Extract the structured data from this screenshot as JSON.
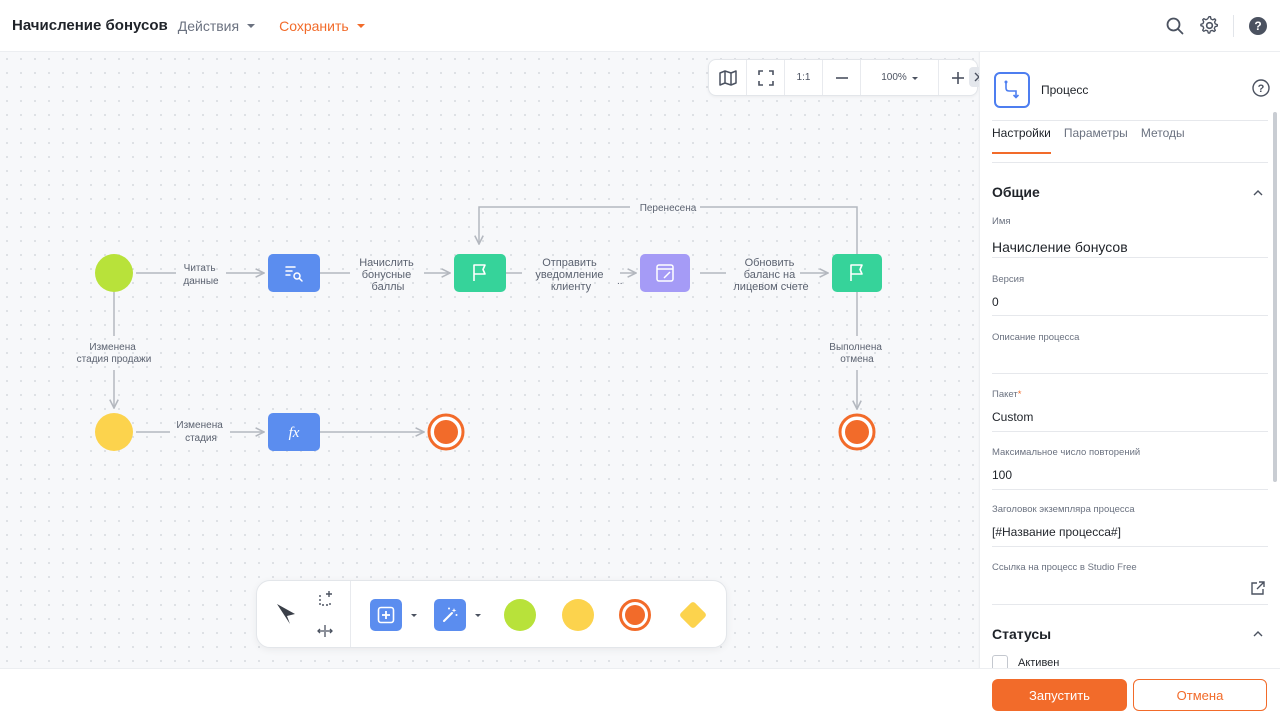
{
  "header": {
    "title": "Начисление бонусов",
    "actions_label": "Действия",
    "save_label": "Сохранить"
  },
  "colors": {
    "accent": "#f26b2a",
    "start": "#b8e23a",
    "intermediate": "#fcd34d",
    "end": "#f26b2a",
    "task_blue": "#5b8def",
    "task_green": "#36d39a",
    "task_purple": "#a59bf6"
  },
  "zoom": {
    "one_to_one": "1:1",
    "level": "100%"
  },
  "diagram": {
    "edges": {
      "read_data": [
        "Читать",
        "данные"
      ],
      "accrue_points": [
        "Начислить",
        "бонусные",
        "баллы"
      ],
      "send_notification": [
        "Отправить",
        "уведомление",
        "клиенту"
      ],
      "update_balance": [
        "Обновить",
        "баланс на",
        "лицевом счете"
      ],
      "transferred": "Перенесена",
      "sale_stage_changed": [
        "Изменена",
        "стадия продажи"
      ],
      "stage_changed": [
        "Изменена",
        "стадия"
      ],
      "cancel_done": [
        "Выполнена",
        "отмена"
      ]
    },
    "function_label": "fx"
  },
  "panel": {
    "process_title": "Процесс",
    "tabs": [
      "Настройки",
      "Параметры",
      "Методы"
    ],
    "general_title": "Общие",
    "fields": {
      "name": {
        "label": "Имя",
        "value": "Начисление бонусов"
      },
      "version": {
        "label": "Версия",
        "value": "0"
      },
      "description": {
        "label": "Описание процесса",
        "value": ""
      },
      "package": {
        "label": "Пакет",
        "required_mark": "*",
        "value": "Custom"
      },
      "max_retries": {
        "label": "Максимальное число повторений",
        "value": "100"
      },
      "instance_title": {
        "label": "Заголовок экземпляра процесса",
        "value": "[#Название процесса#]"
      },
      "studio_link": {
        "label": "Ссылка на процесс в Studio Free",
        "value": ""
      }
    },
    "statuses_title": "Статусы",
    "active_label": "Активен"
  },
  "footer": {
    "run_label": "Запустить",
    "cancel_label": "Отмена"
  }
}
